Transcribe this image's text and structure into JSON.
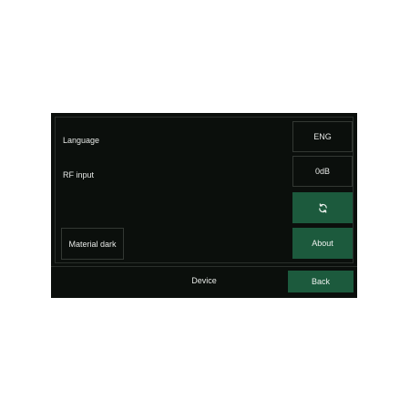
{
  "settings": {
    "language_label": "Language",
    "language_value": "ENG",
    "rf_input_label": "RF input",
    "rf_input_value": "0dB",
    "refresh_icon": "refresh-icon",
    "theme_value": "Material dark",
    "about_label": "About"
  },
  "footer": {
    "title": "Device",
    "back_label": "Back"
  },
  "colors": {
    "background": "#0b0f0c",
    "accent": "#1c5a3d",
    "border": "#333833",
    "text": "#e6e8e6"
  }
}
